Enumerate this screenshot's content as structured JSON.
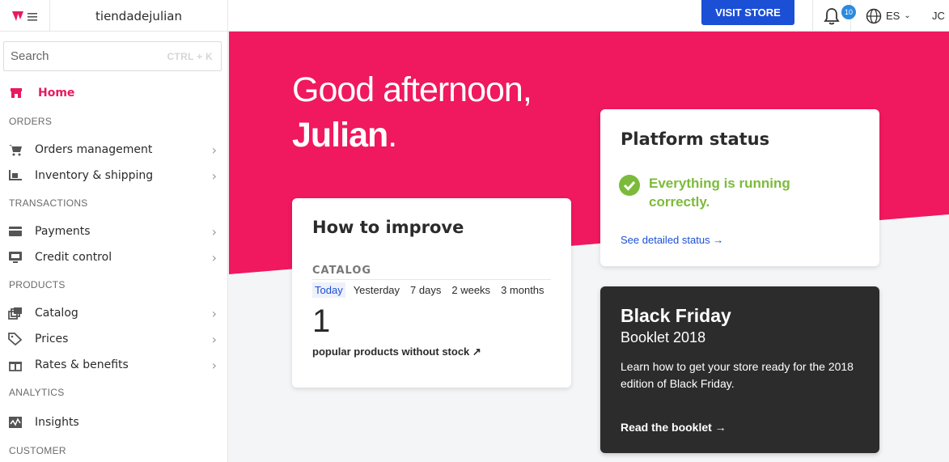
{
  "topbar": {
    "logo_icon": "brand-logo-icon",
    "store_name": "tiendadejulian",
    "visit_store_label": "VISIT STORE",
    "notifications_count": "10",
    "language": "ES",
    "user_initials": "JC"
  },
  "sidebar": {
    "search_placeholder": "Search",
    "search_shortcut": "CTRL + K",
    "home_label": "Home",
    "sections": {
      "orders": "ORDERS",
      "transactions": "TRANSACTIONS",
      "products": "PRODUCTS",
      "analytics": "ANALYTICS",
      "customer": "CUSTOMER"
    },
    "items": {
      "orders_management": "Orders management",
      "inventory_shipping": "Inventory & shipping",
      "payments": "Payments",
      "credit_control": "Credit control",
      "catalog": "Catalog",
      "prices": "Prices",
      "rates_benefits": "Rates & benefits",
      "insights": "Insights"
    }
  },
  "hero": {
    "greeting_line1": "Good afternoon,",
    "greeting_name": "Julian",
    "greeting_end": ".",
    "accent_color": "#f0185f"
  },
  "improve": {
    "title": "How to improve",
    "section": "CATALOG",
    "tabs": [
      "Today",
      "Yesterday",
      "7 days",
      "2 weeks",
      "3 months"
    ],
    "active_tab": "Today",
    "value": "1",
    "caption": "popular products without stock ↗"
  },
  "platform_status": {
    "title": "Platform status",
    "message": "Everything is running correctly.",
    "link": "See detailed status →"
  },
  "black_friday": {
    "title": "Black Friday",
    "subtitle": "Booklet 2018",
    "description": "Learn how to get your store ready for the 2018 edition of Black Friday.",
    "link": "Read the booklet →"
  }
}
